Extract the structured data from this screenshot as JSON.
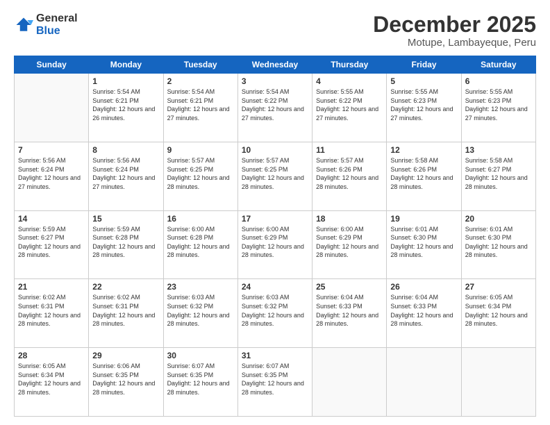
{
  "logo": {
    "general": "General",
    "blue": "Blue"
  },
  "header": {
    "month": "December 2025",
    "location": "Motupe, Lambayeque, Peru"
  },
  "weekdays": [
    "Sunday",
    "Monday",
    "Tuesday",
    "Wednesday",
    "Thursday",
    "Friday",
    "Saturday"
  ],
  "weeks": [
    [
      {
        "day": "",
        "sunrise": "",
        "sunset": "",
        "daylight": ""
      },
      {
        "day": "1",
        "sunrise": "Sunrise: 5:54 AM",
        "sunset": "Sunset: 6:21 PM",
        "daylight": "Daylight: 12 hours and 26 minutes."
      },
      {
        "day": "2",
        "sunrise": "Sunrise: 5:54 AM",
        "sunset": "Sunset: 6:21 PM",
        "daylight": "Daylight: 12 hours and 27 minutes."
      },
      {
        "day": "3",
        "sunrise": "Sunrise: 5:54 AM",
        "sunset": "Sunset: 6:22 PM",
        "daylight": "Daylight: 12 hours and 27 minutes."
      },
      {
        "day": "4",
        "sunrise": "Sunrise: 5:55 AM",
        "sunset": "Sunset: 6:22 PM",
        "daylight": "Daylight: 12 hours and 27 minutes."
      },
      {
        "day": "5",
        "sunrise": "Sunrise: 5:55 AM",
        "sunset": "Sunset: 6:23 PM",
        "daylight": "Daylight: 12 hours and 27 minutes."
      },
      {
        "day": "6",
        "sunrise": "Sunrise: 5:55 AM",
        "sunset": "Sunset: 6:23 PM",
        "daylight": "Daylight: 12 hours and 27 minutes."
      }
    ],
    [
      {
        "day": "7",
        "sunrise": "Sunrise: 5:56 AM",
        "sunset": "Sunset: 6:24 PM",
        "daylight": "Daylight: 12 hours and 27 minutes."
      },
      {
        "day": "8",
        "sunrise": "Sunrise: 5:56 AM",
        "sunset": "Sunset: 6:24 PM",
        "daylight": "Daylight: 12 hours and 27 minutes."
      },
      {
        "day": "9",
        "sunrise": "Sunrise: 5:57 AM",
        "sunset": "Sunset: 6:25 PM",
        "daylight": "Daylight: 12 hours and 28 minutes."
      },
      {
        "day": "10",
        "sunrise": "Sunrise: 5:57 AM",
        "sunset": "Sunset: 6:25 PM",
        "daylight": "Daylight: 12 hours and 28 minutes."
      },
      {
        "day": "11",
        "sunrise": "Sunrise: 5:57 AM",
        "sunset": "Sunset: 6:26 PM",
        "daylight": "Daylight: 12 hours and 28 minutes."
      },
      {
        "day": "12",
        "sunrise": "Sunrise: 5:58 AM",
        "sunset": "Sunset: 6:26 PM",
        "daylight": "Daylight: 12 hours and 28 minutes."
      },
      {
        "day": "13",
        "sunrise": "Sunrise: 5:58 AM",
        "sunset": "Sunset: 6:27 PM",
        "daylight": "Daylight: 12 hours and 28 minutes."
      }
    ],
    [
      {
        "day": "14",
        "sunrise": "Sunrise: 5:59 AM",
        "sunset": "Sunset: 6:27 PM",
        "daylight": "Daylight: 12 hours and 28 minutes."
      },
      {
        "day": "15",
        "sunrise": "Sunrise: 5:59 AM",
        "sunset": "Sunset: 6:28 PM",
        "daylight": "Daylight: 12 hours and 28 minutes."
      },
      {
        "day": "16",
        "sunrise": "Sunrise: 6:00 AM",
        "sunset": "Sunset: 6:28 PM",
        "daylight": "Daylight: 12 hours and 28 minutes."
      },
      {
        "day": "17",
        "sunrise": "Sunrise: 6:00 AM",
        "sunset": "Sunset: 6:29 PM",
        "daylight": "Daylight: 12 hours and 28 minutes."
      },
      {
        "day": "18",
        "sunrise": "Sunrise: 6:00 AM",
        "sunset": "Sunset: 6:29 PM",
        "daylight": "Daylight: 12 hours and 28 minutes."
      },
      {
        "day": "19",
        "sunrise": "Sunrise: 6:01 AM",
        "sunset": "Sunset: 6:30 PM",
        "daylight": "Daylight: 12 hours and 28 minutes."
      },
      {
        "day": "20",
        "sunrise": "Sunrise: 6:01 AM",
        "sunset": "Sunset: 6:30 PM",
        "daylight": "Daylight: 12 hours and 28 minutes."
      }
    ],
    [
      {
        "day": "21",
        "sunrise": "Sunrise: 6:02 AM",
        "sunset": "Sunset: 6:31 PM",
        "daylight": "Daylight: 12 hours and 28 minutes."
      },
      {
        "day": "22",
        "sunrise": "Sunrise: 6:02 AM",
        "sunset": "Sunset: 6:31 PM",
        "daylight": "Daylight: 12 hours and 28 minutes."
      },
      {
        "day": "23",
        "sunrise": "Sunrise: 6:03 AM",
        "sunset": "Sunset: 6:32 PM",
        "daylight": "Daylight: 12 hours and 28 minutes."
      },
      {
        "day": "24",
        "sunrise": "Sunrise: 6:03 AM",
        "sunset": "Sunset: 6:32 PM",
        "daylight": "Daylight: 12 hours and 28 minutes."
      },
      {
        "day": "25",
        "sunrise": "Sunrise: 6:04 AM",
        "sunset": "Sunset: 6:33 PM",
        "daylight": "Daylight: 12 hours and 28 minutes."
      },
      {
        "day": "26",
        "sunrise": "Sunrise: 6:04 AM",
        "sunset": "Sunset: 6:33 PM",
        "daylight": "Daylight: 12 hours and 28 minutes."
      },
      {
        "day": "27",
        "sunrise": "Sunrise: 6:05 AM",
        "sunset": "Sunset: 6:34 PM",
        "daylight": "Daylight: 12 hours and 28 minutes."
      }
    ],
    [
      {
        "day": "28",
        "sunrise": "Sunrise: 6:05 AM",
        "sunset": "Sunset: 6:34 PM",
        "daylight": "Daylight: 12 hours and 28 minutes."
      },
      {
        "day": "29",
        "sunrise": "Sunrise: 6:06 AM",
        "sunset": "Sunset: 6:35 PM",
        "daylight": "Daylight: 12 hours and 28 minutes."
      },
      {
        "day": "30",
        "sunrise": "Sunrise: 6:07 AM",
        "sunset": "Sunset: 6:35 PM",
        "daylight": "Daylight: 12 hours and 28 minutes."
      },
      {
        "day": "31",
        "sunrise": "Sunrise: 6:07 AM",
        "sunset": "Sunset: 6:35 PM",
        "daylight": "Daylight: 12 hours and 28 minutes."
      },
      {
        "day": "",
        "sunrise": "",
        "sunset": "",
        "daylight": ""
      },
      {
        "day": "",
        "sunrise": "",
        "sunset": "",
        "daylight": ""
      },
      {
        "day": "",
        "sunrise": "",
        "sunset": "",
        "daylight": ""
      }
    ]
  ]
}
